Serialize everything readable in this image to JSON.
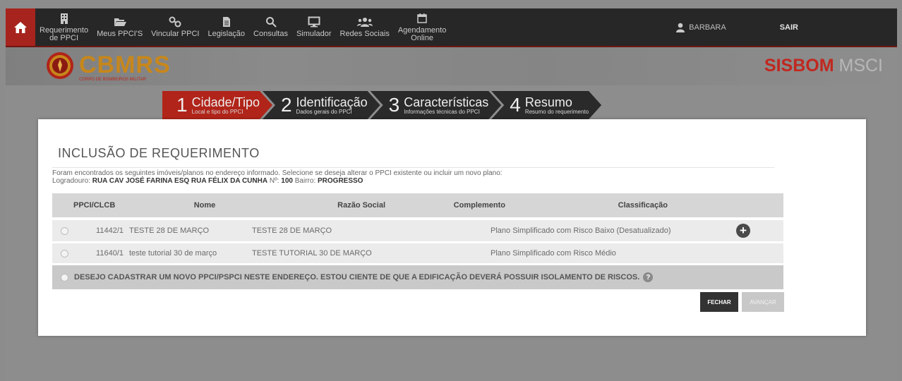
{
  "nav": {
    "items": [
      {
        "label1": "Requerimento",
        "label2": "de PPCI",
        "icon": "building-icon"
      },
      {
        "label1": "Meus PPCI'S",
        "icon": "folder-open-icon"
      },
      {
        "label1": "Vincular PPCI",
        "icon": "link-icon"
      },
      {
        "label1": "Legislação",
        "icon": "document-icon"
      },
      {
        "label1": "Consultas",
        "icon": "search-icon"
      },
      {
        "label1": "Simulador",
        "icon": "monitor-icon"
      },
      {
        "label1": "Redes Sociais",
        "icon": "users-icon"
      },
      {
        "label1": "Agendamento",
        "label2": "Online",
        "icon": "calendar-icon"
      }
    ],
    "user": "BARBARA",
    "logout": "SAIR"
  },
  "banner": {
    "brand": "CBMRS",
    "brand_sub": "CORPO DE BOMBEIROS MILITAR",
    "system_a": "SISBOM",
    "system_b": "MSCI"
  },
  "wizard": {
    "steps": [
      {
        "num": "1",
        "title": "Cidade/Tipo",
        "sub": "Local e tipo do PPCI",
        "active": true
      },
      {
        "num": "2",
        "title": "Identificação",
        "sub": "Dados gerais do PPCI",
        "active": false
      },
      {
        "num": "3",
        "title": "Características",
        "sub": "Informações técnicas do PPCI",
        "active": false
      },
      {
        "num": "4",
        "title": "Resumo",
        "sub": "Resumo do requerimento",
        "active": false
      }
    ]
  },
  "modal": {
    "title": "INCLUSÃO DE REQUERIMENTO",
    "info_line1": "Foram encontrados os seguintes imóveis/planos no endereço informado. Selecione se deseja alterar o PPCI existente ou incluir um novo plano:",
    "logradouro_label": "Logradouro:",
    "logradouro_value": "RUA CAV JOSÉ FARINA ESQ RUA FÉLIX DA CUNHA",
    "numero_label": "Nº:",
    "numero_value": "100",
    "bairro_label": "Bairro:",
    "bairro_value": "PROGRESSO",
    "table": {
      "headers": [
        "PPCI/CLCB",
        "Nome",
        "Razão Social",
        "Complemento",
        "Classificação"
      ],
      "rows": [
        {
          "ppci": "11442/1",
          "nome": "TESTE 28 DE MARÇO",
          "razao": "TESTE 28 DE MARÇO",
          "complemento": "",
          "classificacao": "Plano Simplificado com Risco Baixo (Desatualizado)"
        },
        {
          "ppci": "11640/1",
          "nome": "teste tutorial 30 de março",
          "razao": "TESTE TUTORIAL 30 DE MARÇO",
          "complemento": "",
          "classificacao": "Plano Simplificado com Risco Médio"
        }
      ],
      "new_option": "DESEJO CADASTRAR UM NOVO PPCI/PSPCI NESTE ENDEREÇO. ESTOU CIENTE DE QUE A EDIFICAÇÃO DEVERÁ POSSUIR ISOLAMENTO DE RISCOS.",
      "help_glyph": "?"
    },
    "close_label": "FECHAR",
    "next_label": "AVANÇAR",
    "plus_glyph": "+"
  },
  "colors": {
    "accent_red": "#b12419",
    "nav_bg": "#272727",
    "brand_gold": "#c7871b"
  }
}
